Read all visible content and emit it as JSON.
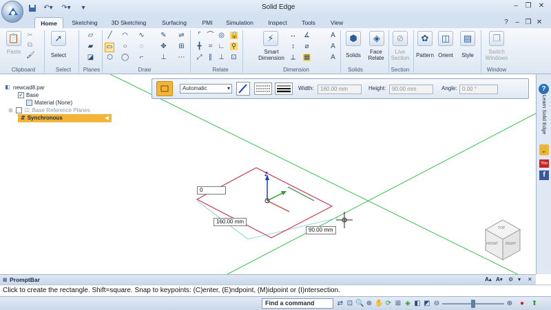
{
  "window": {
    "title": "Solid Edge",
    "controls": [
      "–",
      "❐",
      "✕"
    ],
    "ribbon_controls": [
      "?",
      "–",
      "❐",
      "✕"
    ]
  },
  "tabs": [
    "Home",
    "Sketching",
    "3D Sketching",
    "Surfacing",
    "PMI",
    "Simulation",
    "Inspect",
    "Tools",
    "View"
  ],
  "ribbon": {
    "groups": [
      "Clipboard",
      "Select",
      "Planes",
      "Draw",
      "Relate",
      "Dimension",
      "Solids",
      "Section",
      "Window"
    ],
    "buttons": {
      "paste": "Paste",
      "select": "Select",
      "smart": "Smart",
      "dimension": "Dimension",
      "solids": "Solids",
      "face": "Face",
      "relate": "Relate",
      "live": "Live",
      "section": "Section",
      "pattern": "Pattern",
      "orient": "Orient",
      "style": "Style",
      "switch": "Switch",
      "windows": "Windows"
    }
  },
  "pathfinder": {
    "root": "newcad8.par",
    "base": "Base",
    "material": "Material (None)",
    "ref_planes": "Base Reference Planes",
    "sync": "Synchronous"
  },
  "command_bar": {
    "mode": "Automatic",
    "width_label": "Width:",
    "width_value": "160.00 mm",
    "height_label": "Height:",
    "height_value": "90.00 mm",
    "angle_label": "Angle:",
    "angle_value": "0.00 °"
  },
  "canvas": {
    "input_value": "0",
    "dim_width": "160.00 mm",
    "dim_height": "90.00 mm",
    "axis_z": "Z",
    "view_cube": {
      "top": "TOP",
      "front": "FRONT",
      "right": "RIGHT"
    }
  },
  "side_panel": {
    "learn": "Learn Solid Edge"
  },
  "promptbar": {
    "title": "PromptBar",
    "message": "Click to create the rectangle.  Shift=square.  Snap to keypoints: (C)enter, (E)ndpoint, (M)idpoint or (I)ntersection."
  },
  "status": {
    "find_placeholder": "Find a command"
  },
  "colors": {
    "accent": "#f3b43a",
    "sketch_line": "#c8394f",
    "ref_plane": "#33c24d",
    "ribbon_bg": "#dde7f3"
  }
}
